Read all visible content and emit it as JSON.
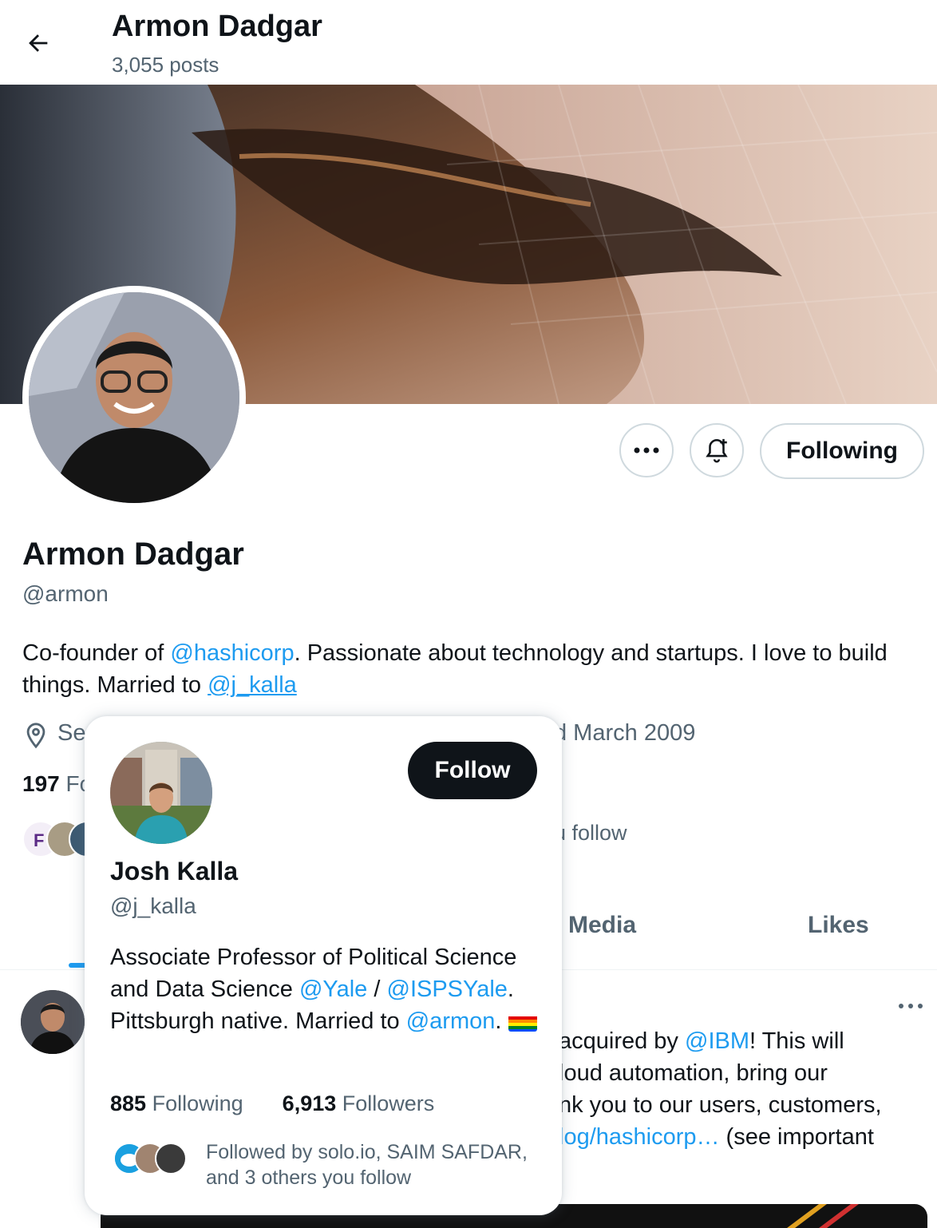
{
  "header": {
    "title": "Armon Dadgar",
    "posts": "3,055 posts"
  },
  "profile": {
    "name": "Armon Dadgar",
    "handle": "@armon",
    "bio_prefix": "Co-founder of ",
    "bio_link_1": "@hashicorp",
    "bio_middle": ". Passionate about technology and startups. I love to build things. Married to ",
    "bio_link_2": "@j_kalla",
    "location_partial": "Se",
    "joined_partial": "d March 2009",
    "following_count": "197",
    "following_label_partial": "Fo",
    "followed_by_partial": "u follow",
    "following_button": "Following"
  },
  "tabs": {
    "media": "Media",
    "likes": "Likes"
  },
  "post": {
    "line1_pre": "acquired by ",
    "line1_link": "@IBM",
    "line1_post": "! This will",
    "line2": "loud automation, bring our",
    "line3": "nk you to our users, customers,",
    "line4_link": "log/hashicorp…",
    "line4_post": " (see important"
  },
  "hover_card": {
    "name": "Josh Kalla",
    "handle": "@j_kalla",
    "follow_button": "Follow",
    "bio_1": "Associate Professor of Political Science and Data Science ",
    "bio_link_yale": "@Yale",
    "bio_2": " / ",
    "bio_link_isps": "@ISPSYale",
    "bio_3": ". Pittsburgh native. Married to ",
    "bio_link_armon": "@armon",
    "bio_4": ". ",
    "flag": "🏳️‍🌈",
    "following_count": "885",
    "following_label": "Following",
    "followers_count": "6,913",
    "followers_label": "Followers",
    "followed_by": "Followed by solo.io, SAIM SAFDAR, and 3 others you follow"
  },
  "colors": {
    "accent": "#1d9bf0",
    "text": "#0f1419",
    "muted": "#536471",
    "border": "#cfd9de"
  }
}
